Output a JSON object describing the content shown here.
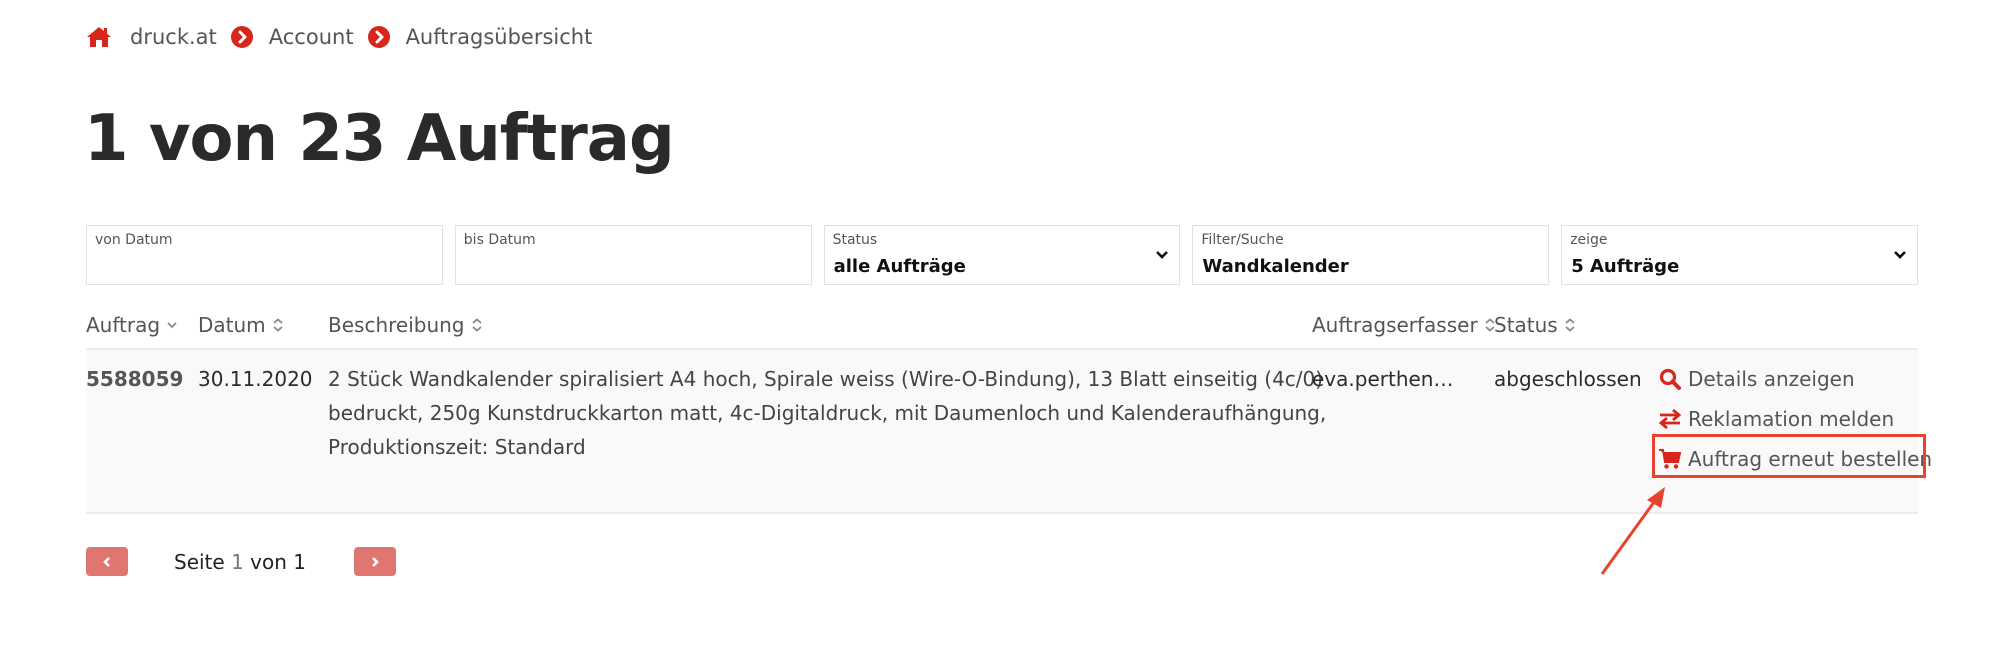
{
  "breadcrumb": {
    "items": [
      "druck.at",
      "Account",
      "Auftragsübersicht"
    ],
    "home_icon": "home-icon",
    "separator_icon": "chevron-circle-right-icon"
  },
  "page_title": "1 von 23 Auftrag",
  "filters": {
    "from_date": {
      "label": "von Datum",
      "value": ""
    },
    "to_date": {
      "label": "bis Datum",
      "value": ""
    },
    "status": {
      "label": "Status",
      "value": "alle Aufträge"
    },
    "search": {
      "label": "Filter/Suche",
      "value": "Wandkalender"
    },
    "show": {
      "label": "zeige",
      "value": "5 Aufträge"
    }
  },
  "table": {
    "columns": [
      {
        "label": "Auftrag",
        "sort": "desc"
      },
      {
        "label": "Datum",
        "sort": "none"
      },
      {
        "label": "Beschreibung",
        "sort": "none"
      },
      {
        "label": "Auftragserfasser",
        "sort": "none"
      },
      {
        "label": "Status",
        "sort": "none"
      }
    ],
    "rows": [
      {
        "order_no": "5588059",
        "date": "30.11.2020",
        "description": "2 Stück Wandkalender spiralisiert A4 hoch, Spirale weiss (Wire-O-Bindung), 13 Blatt einseitig (4c/0) bedruckt, 250g Kunstdruckkarton matt, 4c-Digitaldruck, mit Daumenloch und Kalenderaufhängung, Produktionszeit: Standard",
        "creator": "eva.perthen…",
        "status": "abgeschlossen",
        "actions": [
          {
            "label": "Details anzeigen",
            "icon": "search-icon"
          },
          {
            "label": "Reklamation melden",
            "icon": "exchange-icon"
          },
          {
            "label": "Auftrag erneut bestellen",
            "icon": "cart-icon"
          }
        ]
      }
    ]
  },
  "pagination": {
    "prefix": "Seite",
    "current": "1",
    "middle": "von",
    "total": "1"
  },
  "colors": {
    "accent": "#d9261c",
    "annotation": "#e8432d",
    "pager_button": "#e07670"
  }
}
